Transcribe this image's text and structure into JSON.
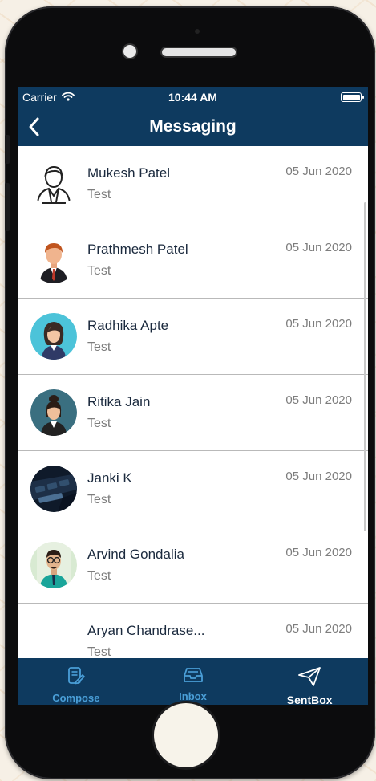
{
  "status_bar": {
    "carrier": "Carrier",
    "time": "10:44 AM"
  },
  "nav": {
    "title": "Messaging",
    "back_icon": "chevron-left-icon"
  },
  "messages": [
    {
      "name": "Mukesh Patel",
      "preview": "Test",
      "date": "05 Jun 2020",
      "avatar": "outline-man-avatar"
    },
    {
      "name": "Prathmesh Patel",
      "preview": "Test",
      "date": "05 Jun 2020",
      "avatar": "businessman-avatar"
    },
    {
      "name": "Radhika Apte",
      "preview": "Test",
      "date": "05 Jun 2020",
      "avatar": "woman-avatar"
    },
    {
      "name": "Ritika Jain",
      "preview": "Test",
      "date": "05 Jun 2020",
      "avatar": "woman-avatar"
    },
    {
      "name": "Janki K",
      "preview": "Test",
      "date": "05 Jun 2020",
      "avatar": "keyboard-photo-avatar"
    },
    {
      "name": "Arvind Gondalia",
      "preview": "Test",
      "date": "05 Jun 2020",
      "avatar": "man-with-glasses-avatar"
    },
    {
      "name": "Aryan Chandrase...",
      "preview": "Test",
      "date": "05 Jun 2020",
      "avatar": ""
    }
  ],
  "tabs": [
    {
      "label": "Compose",
      "icon": "compose-icon",
      "active": false
    },
    {
      "label": "Inbox",
      "icon": "inbox-icon",
      "active": false
    },
    {
      "label": "SentBox",
      "icon": "paper-plane-icon",
      "active": true
    }
  ],
  "colors": {
    "header_bg": "#0e3a5f",
    "tab_inactive": "#4a9fd8",
    "tab_active": "#ffffff"
  }
}
